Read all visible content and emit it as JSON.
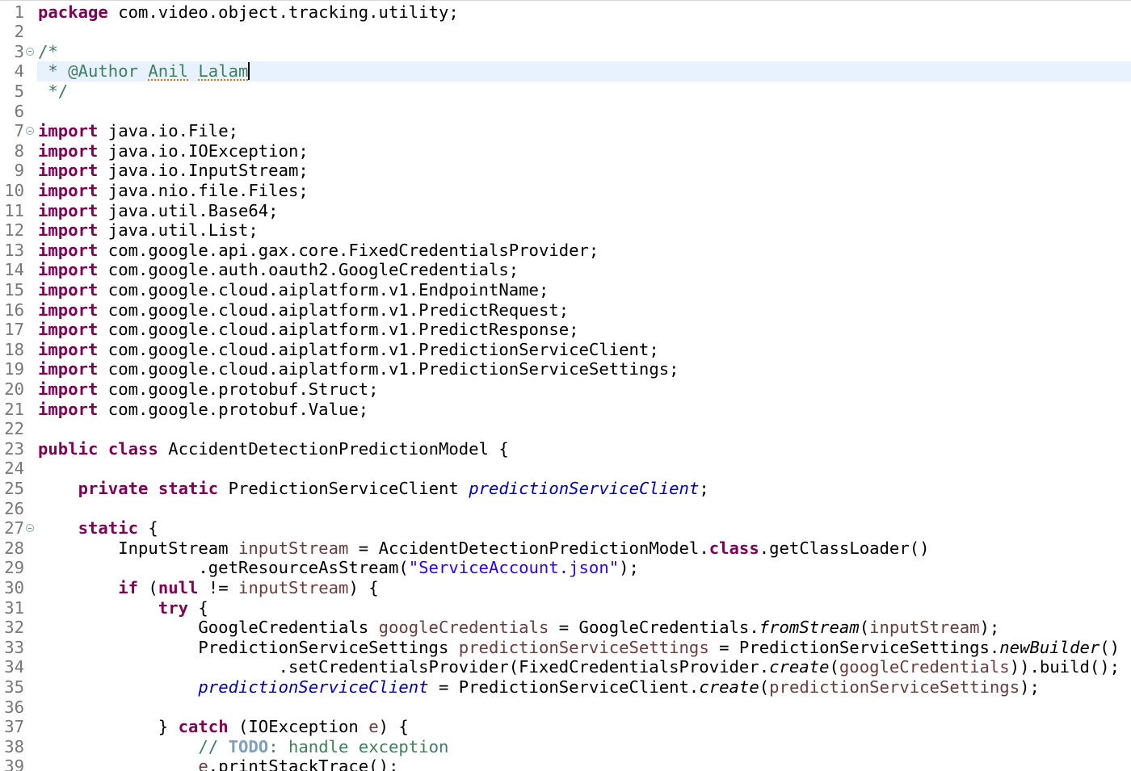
{
  "editor": {
    "current_line": 4,
    "lines": [
      {
        "n": "1",
        "tokens": [
          {
            "t": "package",
            "c": "kw"
          },
          {
            "t": " com.video.object.tracking.utility;"
          }
        ]
      },
      {
        "n": "2",
        "tokens": []
      },
      {
        "n": "3",
        "fold": true,
        "tokens": [
          {
            "t": "/*",
            "c": "cm"
          }
        ]
      },
      {
        "n": "4",
        "caret": true,
        "tokens": [
          {
            "t": " * @Author ",
            "c": "cm"
          },
          {
            "t": "Anil",
            "c": "cm spell"
          },
          {
            "t": " ",
            "c": "cm"
          },
          {
            "t": "Lalam",
            "c": "cm spell"
          }
        ]
      },
      {
        "n": "5",
        "tokens": [
          {
            "t": " */",
            "c": "cm"
          }
        ]
      },
      {
        "n": "6",
        "tokens": []
      },
      {
        "n": "7",
        "fold": true,
        "tokens": [
          {
            "t": "import",
            "c": "kw"
          },
          {
            "t": " java.io.File;"
          }
        ]
      },
      {
        "n": "8",
        "tokens": [
          {
            "t": "import",
            "c": "kw"
          },
          {
            "t": " java.io.IOException;"
          }
        ]
      },
      {
        "n": "9",
        "tokens": [
          {
            "t": "import",
            "c": "kw"
          },
          {
            "t": " java.io.InputStream;"
          }
        ]
      },
      {
        "n": "10",
        "tokens": [
          {
            "t": "import",
            "c": "kw"
          },
          {
            "t": " java.nio.file.Files;"
          }
        ]
      },
      {
        "n": "11",
        "tokens": [
          {
            "t": "import",
            "c": "kw"
          },
          {
            "t": " java.util.Base64;"
          }
        ]
      },
      {
        "n": "12",
        "tokens": [
          {
            "t": "import",
            "c": "kw"
          },
          {
            "t": " java.util.List;"
          }
        ]
      },
      {
        "n": "13",
        "tokens": [
          {
            "t": "import",
            "c": "kw"
          },
          {
            "t": " com.google.api.gax.core.FixedCredentialsProvider;"
          }
        ]
      },
      {
        "n": "14",
        "tokens": [
          {
            "t": "import",
            "c": "kw"
          },
          {
            "t": " com.google.auth.oauth2.GoogleCredentials;"
          }
        ]
      },
      {
        "n": "15",
        "tokens": [
          {
            "t": "import",
            "c": "kw"
          },
          {
            "t": " com.google.cloud.aiplatform.v1.EndpointName;"
          }
        ]
      },
      {
        "n": "16",
        "tokens": [
          {
            "t": "import",
            "c": "kw"
          },
          {
            "t": " com.google.cloud.aiplatform.v1.PredictRequest;"
          }
        ]
      },
      {
        "n": "17",
        "tokens": [
          {
            "t": "import",
            "c": "kw"
          },
          {
            "t": " com.google.cloud.aiplatform.v1.PredictResponse;"
          }
        ]
      },
      {
        "n": "18",
        "tokens": [
          {
            "t": "import",
            "c": "kw"
          },
          {
            "t": " com.google.cloud.aiplatform.v1.PredictionServiceClient;"
          }
        ]
      },
      {
        "n": "19",
        "tokens": [
          {
            "t": "import",
            "c": "kw"
          },
          {
            "t": " com.google.cloud.aiplatform.v1.PredictionServiceSettings;"
          }
        ]
      },
      {
        "n": "20",
        "tokens": [
          {
            "t": "import",
            "c": "kw"
          },
          {
            "t": " com.google.protobuf.Struct;"
          }
        ]
      },
      {
        "n": "21",
        "tokens": [
          {
            "t": "import",
            "c": "kw"
          },
          {
            "t": " com.google.protobuf.Value;"
          }
        ]
      },
      {
        "n": "22",
        "tokens": []
      },
      {
        "n": "23",
        "tokens": [
          {
            "t": "public",
            "c": "kw"
          },
          {
            "t": " "
          },
          {
            "t": "class",
            "c": "kw"
          },
          {
            "t": " AccidentDetectionPredictionModel {"
          }
        ]
      },
      {
        "n": "24",
        "tokens": []
      },
      {
        "n": "25",
        "tokens": [
          {
            "t": "    "
          },
          {
            "t": "private",
            "c": "kw"
          },
          {
            "t": " "
          },
          {
            "t": "static",
            "c": "kw"
          },
          {
            "t": " PredictionServiceClient "
          },
          {
            "t": "predictionServiceClient",
            "c": "fld"
          },
          {
            "t": ";"
          }
        ]
      },
      {
        "n": "26",
        "tokens": []
      },
      {
        "n": "27",
        "fold": true,
        "tokens": [
          {
            "t": "    "
          },
          {
            "t": "static",
            "c": "kw"
          },
          {
            "t": " {"
          }
        ]
      },
      {
        "n": "28",
        "tokens": [
          {
            "t": "        InputStream "
          },
          {
            "t": "inputStream",
            "c": "var"
          },
          {
            "t": " = AccidentDetectionPredictionModel."
          },
          {
            "t": "class",
            "c": "kw"
          },
          {
            "t": ".getClassLoader()"
          }
        ]
      },
      {
        "n": "29",
        "tokens": [
          {
            "t": "                .getResourceAsStream("
          },
          {
            "t": "\"ServiceAccount.json\"",
            "c": "str"
          },
          {
            "t": ");"
          }
        ]
      },
      {
        "n": "30",
        "tokens": [
          {
            "t": "        "
          },
          {
            "t": "if",
            "c": "kw"
          },
          {
            "t": " ("
          },
          {
            "t": "null",
            "c": "kw"
          },
          {
            "t": " != "
          },
          {
            "t": "inputStream",
            "c": "var"
          },
          {
            "t": ") {"
          }
        ]
      },
      {
        "n": "31",
        "tokens": [
          {
            "t": "            "
          },
          {
            "t": "try",
            "c": "kw"
          },
          {
            "t": " {"
          }
        ]
      },
      {
        "n": "32",
        "tokens": [
          {
            "t": "                GoogleCredentials "
          },
          {
            "t": "googleCredentials",
            "c": "var"
          },
          {
            "t": " = GoogleCredentials."
          },
          {
            "t": "fromStream",
            "c": "ital"
          },
          {
            "t": "("
          },
          {
            "t": "inputStream",
            "c": "var"
          },
          {
            "t": ");"
          }
        ]
      },
      {
        "n": "33",
        "tokens": [
          {
            "t": "                PredictionServiceSettings "
          },
          {
            "t": "predictionServiceSettings",
            "c": "var"
          },
          {
            "t": " = PredictionServiceSettings."
          },
          {
            "t": "newBuilder",
            "c": "ital"
          },
          {
            "t": "()"
          }
        ]
      },
      {
        "n": "34",
        "tokens": [
          {
            "t": "                        .setCredentialsProvider(FixedCredentialsProvider."
          },
          {
            "t": "create",
            "c": "ital"
          },
          {
            "t": "("
          },
          {
            "t": "googleCredentials",
            "c": "var"
          },
          {
            "t": ")).build();"
          }
        ]
      },
      {
        "n": "35",
        "tokens": [
          {
            "t": "                "
          },
          {
            "t": "predictionServiceClient",
            "c": "fld"
          },
          {
            "t": " = PredictionServiceClient."
          },
          {
            "t": "create",
            "c": "ital"
          },
          {
            "t": "("
          },
          {
            "t": "predictionServiceSettings",
            "c": "var"
          },
          {
            "t": ");"
          }
        ]
      },
      {
        "n": "36",
        "tokens": []
      },
      {
        "n": "37",
        "tokens": [
          {
            "t": "            } "
          },
          {
            "t": "catch",
            "c": "kw"
          },
          {
            "t": " (IOException "
          },
          {
            "t": "e",
            "c": "var"
          },
          {
            "t": ") {"
          }
        ]
      },
      {
        "n": "38",
        "tokens": [
          {
            "t": "                "
          },
          {
            "t": "// ",
            "c": "cm"
          },
          {
            "t": "TODO",
            "c": "todo"
          },
          {
            "t": ": handle exception",
            "c": "cm"
          }
        ]
      },
      {
        "n": "39",
        "tokens": [
          {
            "t": "                "
          },
          {
            "t": "e",
            "c": "var"
          },
          {
            "t": ".printStackTrace();"
          }
        ]
      }
    ]
  }
}
